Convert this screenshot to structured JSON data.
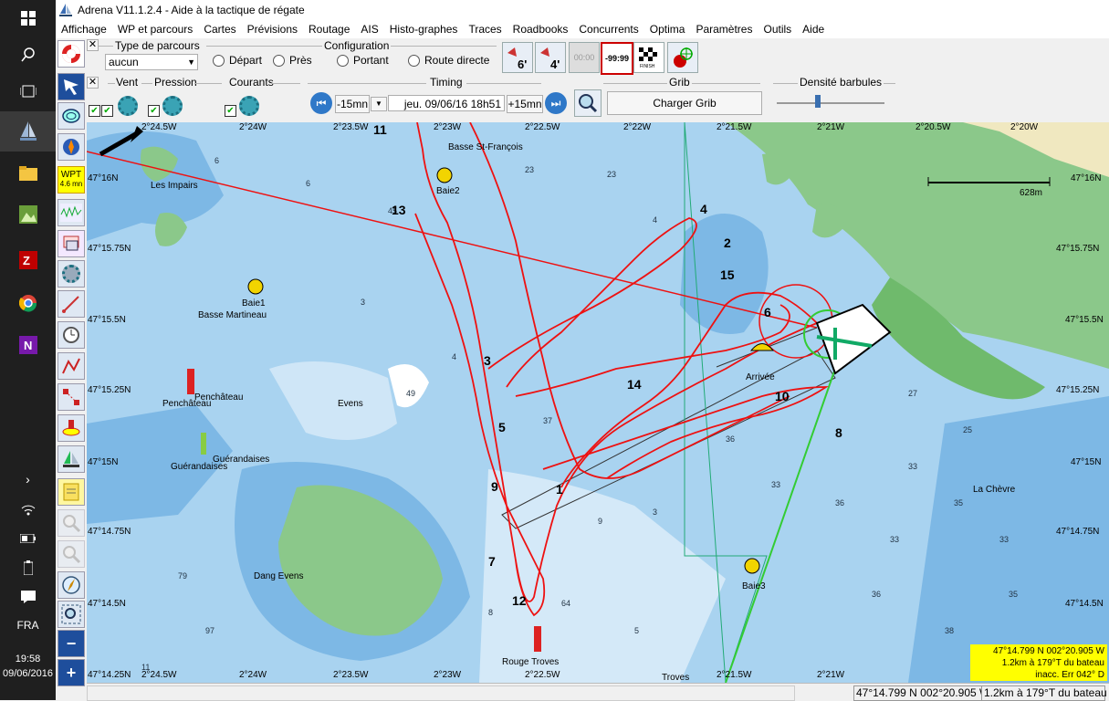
{
  "window": {
    "title": "Adrena V11.1.2.4 - Aide à la tactique de régate"
  },
  "menu": [
    "Affichage",
    "WP et parcours",
    "Cartes",
    "Prévisions",
    "Routage",
    "AIS",
    "Histo-graphes",
    "Traces",
    "Roadbooks",
    "Concurrents",
    "Optima",
    "Paramètres",
    "Outils",
    "Aide"
  ],
  "toolbar": {
    "course_type_label": "Type de parcours",
    "course_type_value": "aucun",
    "config_label": "Configuration",
    "config_options": [
      "Départ",
      "Près",
      "Portant",
      "Route directe"
    ],
    "wind_label": "Vent",
    "pressure_label": "Pression",
    "currents_label": "Courants",
    "timing_label": "Timing",
    "minus15": "-15mn",
    "datetime": "jeu. 09/06/16 18h51",
    "plus15": "+15mn",
    "grib_label": "Grib",
    "load_grib": "Charger Grib",
    "barb_density_label": "Densité barbules",
    "tack6": "6'",
    "tack4": "4'",
    "timer": "00:00",
    "countdown": "-99:99",
    "finish": "FINISH",
    "wpt_label": "WPT",
    "wpt_dist": "4.6 mn"
  },
  "taskbar": {
    "lang": "FRA",
    "time": "19:58",
    "date": "09/06/2016"
  },
  "map": {
    "top_coords": [
      "2°24.5W",
      "2°24W",
      "2°23.5W",
      "2°23W",
      "2°22.5W",
      "2°22W",
      "2°21.5W",
      "2°21W",
      "2°20.5W",
      "2°20W"
    ],
    "bottom_coords": [
      "47°14.25N",
      "2°24.5W",
      "2°24W",
      "2°23.5W",
      "2°23W",
      "2°22.5W",
      "2°21.5W",
      "2°21W"
    ],
    "left_lat": [
      "47°16N",
      "47°15.75N",
      "47°15.5N",
      "47°15.25N",
      "47°15N",
      "47°14.75N",
      "47°14.5N"
    ],
    "right_lat": [
      "47°16N",
      "47°15.75N",
      "47°15.5N",
      "47°15.25N",
      "47°15N",
      "47°14.75N",
      "47°14.5N"
    ],
    "scale": "628m",
    "places": {
      "les_impairs": "Les Impairs",
      "basse_st_francois": "Basse St-François",
      "baie2": "Baie2",
      "baie1": "Baie1",
      "basse_martineau": "Basse Martineau",
      "penchateau1": "Penchâteau",
      "penchateau2": "Penchâteau",
      "evens": "Evens",
      "guerandaises1": "Guérandaises",
      "guerandaises2": "Guérandaises",
      "dang_evens": "Dang Evens",
      "rouge_troves": "Rouge Troves",
      "baie3": "Baie3",
      "arrivee": "Arrivée",
      "la_chevre": "La Chèvre",
      "troves": "Troves"
    },
    "leg_numbers": [
      "1",
      "2",
      "3",
      "4",
      "5",
      "6",
      "7",
      "8",
      "9",
      "10",
      "11",
      "12",
      "13",
      "14",
      "15"
    ],
    "info_box": [
      "47°14.799 N  002°20.905 W",
      "1.2km à 179°T du bateau",
      "inacc. Err 042° D"
    ]
  },
  "status": {
    "position": "47°14.799 N  002°20.905 W",
    "bearing": "1.2km à 179°T du bateau"
  }
}
